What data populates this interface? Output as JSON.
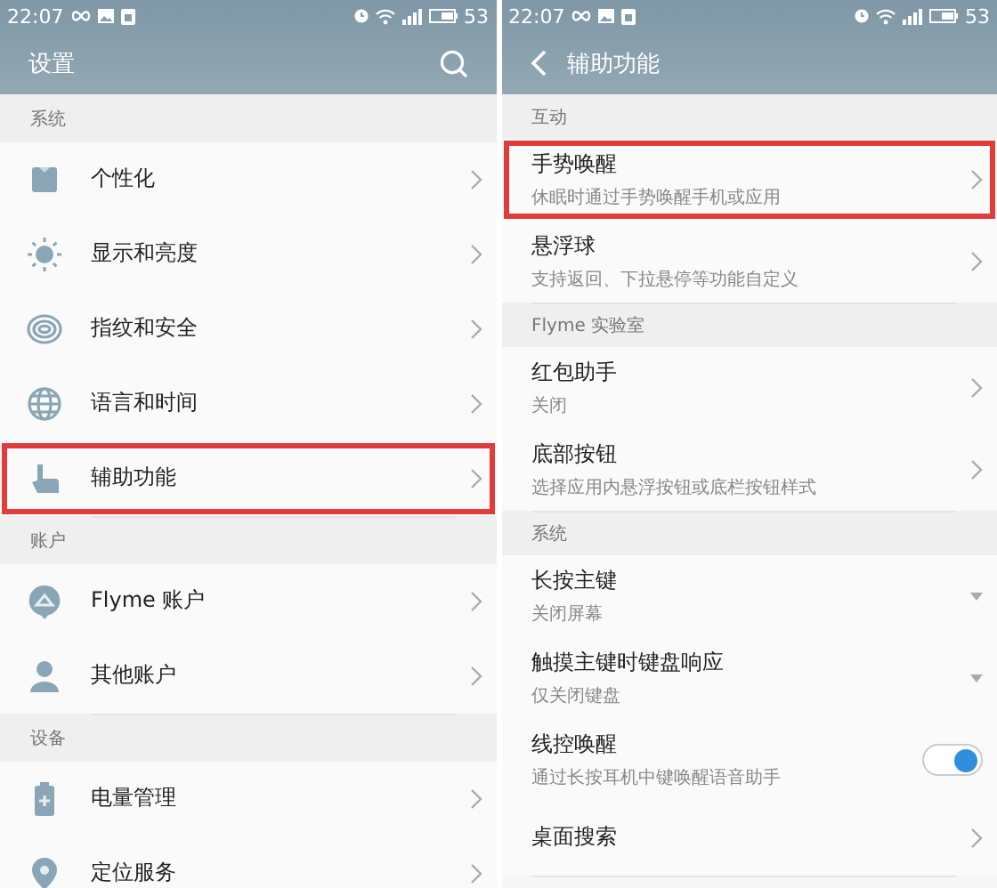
{
  "screens": [
    {
      "status_bar": {
        "time": "22:07",
        "battery": "53"
      },
      "app_bar": {
        "kind": "root",
        "title": "设置"
      },
      "sections": [
        {
          "header": "系统",
          "items": [
            {
              "kind": "chevron",
              "label": "个性化",
              "highlighted": false
            },
            {
              "kind": "chevron",
              "label": "显示和亮度",
              "highlighted": false
            },
            {
              "kind": "chevron",
              "label": "指纹和安全",
              "highlighted": false
            },
            {
              "kind": "chevron",
              "label": "语言和时间",
              "highlighted": false
            },
            {
              "kind": "chevron",
              "label": "辅助功能",
              "highlighted": true
            }
          ]
        },
        {
          "header": "账户",
          "items": [
            {
              "kind": "chevron",
              "label": "Flyme 账户",
              "highlighted": false
            },
            {
              "kind": "chevron",
              "label": "其他账户",
              "highlighted": false
            }
          ]
        },
        {
          "header": "设备",
          "items": [
            {
              "kind": "chevron",
              "label": "电量管理",
              "highlighted": false
            },
            {
              "kind": "chevron",
              "label": "定位服务",
              "highlighted": false
            }
          ]
        }
      ]
    },
    {
      "status_bar": {
        "time": "22:07",
        "battery": "53"
      },
      "app_bar": {
        "kind": "child",
        "title": "辅助功能"
      },
      "sections": [
        {
          "header": "互动",
          "items": [
            {
              "kind": "chevron",
              "label": "手势唤醒",
              "subtitle": "休眠时通过手势唤醒手机或应用",
              "highlighted": true
            },
            {
              "kind": "chevron",
              "label": "悬浮球",
              "subtitle": "支持返回、下拉悬停等功能自定义",
              "highlighted": false
            }
          ]
        },
        {
          "header": "Flyme 实验室",
          "items": [
            {
              "kind": "chevron",
              "label": "红包助手",
              "subtitle": "关闭",
              "highlighted": false
            },
            {
              "kind": "chevron",
              "label": "底部按钮",
              "subtitle": "选择应用内悬浮按钮或底栏按钮样式",
              "highlighted": false
            }
          ]
        },
        {
          "header": "系统",
          "items": [
            {
              "kind": "dropdown",
              "label": "长按主键",
              "subtitle": "关闭屏幕",
              "highlighted": false
            },
            {
              "kind": "dropdown",
              "label": "触摸主键时键盘响应",
              "subtitle": "仅关闭键盘",
              "highlighted": false
            },
            {
              "kind": "toggle",
              "label": "线控唤醒",
              "subtitle": "通过长按耳机中键唤醒语音助手",
              "on": true,
              "highlighted": false
            },
            {
              "kind": "chevron",
              "label": "桌面搜索",
              "highlighted": false
            }
          ]
        }
      ]
    }
  ]
}
